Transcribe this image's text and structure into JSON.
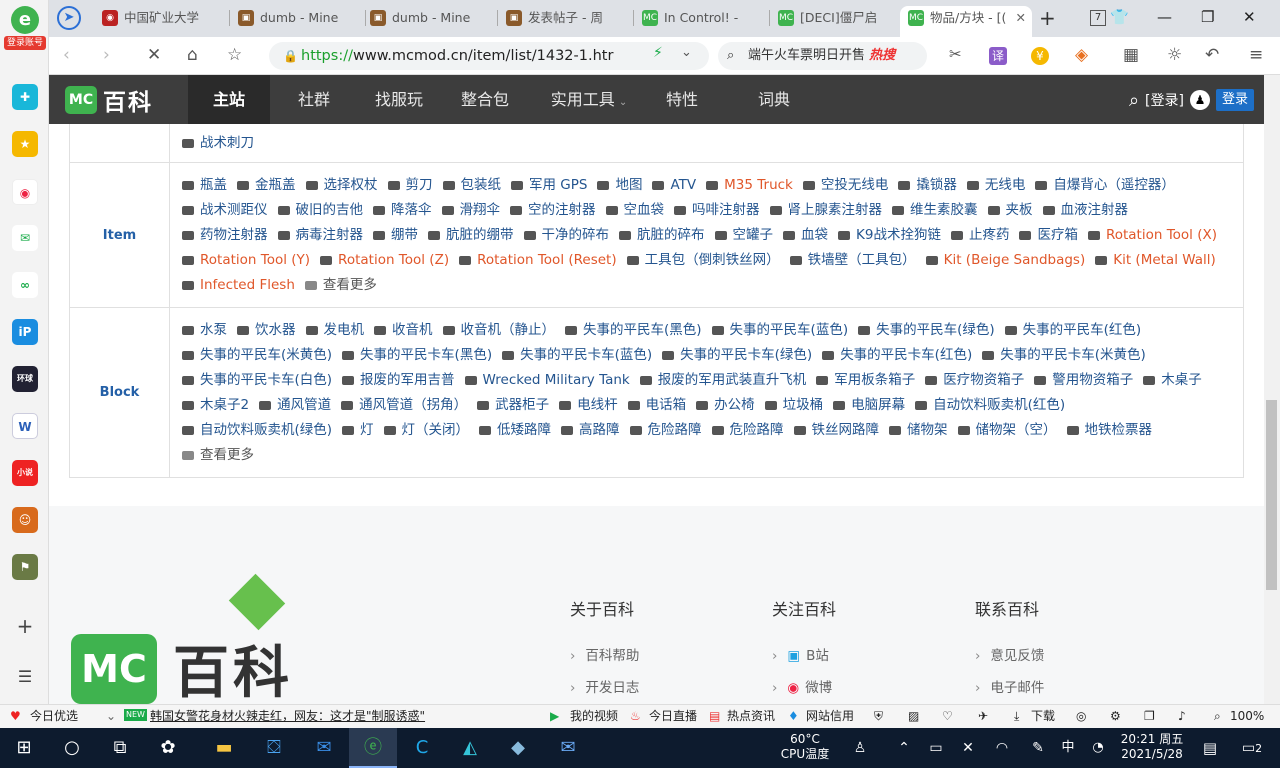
{
  "browser": {
    "login_badge": "登录账号",
    "tabs": [
      {
        "title": "中国矿业大学"
      },
      {
        "title": "dumb - Mine"
      },
      {
        "title": "dumb - Mine"
      },
      {
        "title": "发表帖子 - 周"
      },
      {
        "title": "In Control! -"
      },
      {
        "title": "[DECI]僵尸启"
      },
      {
        "title": "物品/方块 - [("
      }
    ],
    "tab_count": "7",
    "url": "https://www.mcmod.cn/item/list/1432-1.htr",
    "url_scheme": "https://",
    "url_rest": "www.mcmod.cn/item/list/1432-1.htr",
    "search_text": "端午火车票明日开售",
    "search_hot": "热搜"
  },
  "site": {
    "logo_text": "百科",
    "logo_badge": "MC",
    "nav": [
      "主站",
      "社群",
      "找服玩",
      "整合包",
      "实用工具",
      "特性",
      "词典"
    ],
    "login_link": "[登录]",
    "login_button": "登录"
  },
  "content": {
    "top_cell_item": "战术刺刀",
    "item_header": "Item",
    "block_header": "Block",
    "items": [
      {
        "t": "瓶盖"
      },
      {
        "t": "金瓶盖"
      },
      {
        "t": "选择权杖"
      },
      {
        "t": "剪刀"
      },
      {
        "t": "包装纸"
      },
      {
        "t": "军用 GPS"
      },
      {
        "t": "地图"
      },
      {
        "t": "ATV"
      },
      {
        "t": "M35 Truck",
        "red": true
      },
      {
        "t": "空投无线电"
      },
      {
        "t": "撬锁器"
      },
      {
        "t": "无线电"
      },
      {
        "t": "自爆背心（遥控器）"
      },
      {
        "t": "战术测距仪"
      },
      {
        "t": "破旧的吉他"
      },
      {
        "t": "降落伞"
      },
      {
        "t": "滑翔伞"
      },
      {
        "t": "空的注射器"
      },
      {
        "t": "空血袋"
      },
      {
        "t": "吗啡注射器"
      },
      {
        "t": "肾上腺素注射器"
      },
      {
        "t": "维生素胶囊"
      },
      {
        "t": "夹板"
      },
      {
        "t": "血液注射器"
      },
      {
        "t": "药物注射器"
      },
      {
        "t": "病毒注射器"
      },
      {
        "t": "绷带"
      },
      {
        "t": "肮脏的绷带"
      },
      {
        "t": "干净的碎布"
      },
      {
        "t": "肮脏的碎布"
      },
      {
        "t": "空罐子"
      },
      {
        "t": "血袋"
      },
      {
        "t": "K9战术拴狗链"
      },
      {
        "t": "止疼药"
      },
      {
        "t": "医疗箱"
      },
      {
        "t": "Rotation Tool (X)",
        "red": true
      },
      {
        "t": "Rotation Tool (Y)",
        "red": true
      },
      {
        "t": "Rotation Tool (Z)",
        "red": true
      },
      {
        "t": "Rotation Tool (Reset)",
        "red": true
      },
      {
        "t": "工具包（倒刺铁丝网）"
      },
      {
        "t": "铁墙壁（工具包）"
      },
      {
        "t": "Kit (Beige Sandbags)",
        "red": true
      },
      {
        "t": "Kit (Metal Wall)",
        "red": true
      },
      {
        "t": "Infected Flesh",
        "red": true
      }
    ],
    "blocks": [
      {
        "t": "水泵"
      },
      {
        "t": "饮水器"
      },
      {
        "t": "发电机"
      },
      {
        "t": "收音机"
      },
      {
        "t": "收音机（静止）"
      },
      {
        "t": "失事的平民车(黑色)"
      },
      {
        "t": "失事的平民车(蓝色)"
      },
      {
        "t": "失事的平民车(绿色)"
      },
      {
        "t": "失事的平民车(红色)"
      },
      {
        "t": "失事的平民车(米黄色)"
      },
      {
        "t": "失事的平民卡车(黑色)"
      },
      {
        "t": "失事的平民卡车(蓝色)"
      },
      {
        "t": "失事的平民卡车(绿色)"
      },
      {
        "t": "失事的平民卡车(红色)"
      },
      {
        "t": "失事的平民卡车(米黄色)"
      },
      {
        "t": "失事的平民卡车(白色)"
      },
      {
        "t": "报废的军用吉普"
      },
      {
        "t": "Wrecked Military Tank"
      },
      {
        "t": "报废的军用武装直升飞机"
      },
      {
        "t": "军用板条箱子"
      },
      {
        "t": "医疗物资箱子"
      },
      {
        "t": "警用物资箱子"
      },
      {
        "t": "木桌子"
      },
      {
        "t": "木桌子2"
      },
      {
        "t": "通风管道"
      },
      {
        "t": "通风管道（拐角）"
      },
      {
        "t": "武器柜子"
      },
      {
        "t": "电线杆"
      },
      {
        "t": "电话箱"
      },
      {
        "t": "办公椅"
      },
      {
        "t": "垃圾桶"
      },
      {
        "t": "电脑屏幕"
      },
      {
        "t": "自动饮料贩卖机(红色)"
      },
      {
        "t": "自动饮料贩卖机(绿色)"
      },
      {
        "t": "灯"
      },
      {
        "t": "灯（关闭）"
      },
      {
        "t": "低矮路障"
      },
      {
        "t": "高路障"
      },
      {
        "t": "危险路障"
      },
      {
        "t": "危险路障"
      },
      {
        "t": "铁丝网路障"
      },
      {
        "t": "储物架"
      },
      {
        "t": "储物架（空）"
      },
      {
        "t": "地铁检票器"
      }
    ],
    "see_more": "查看更多"
  },
  "footer": {
    "logo_badge": "MC",
    "logo_text": "百科",
    "about": {
      "title": "关于百科",
      "links": [
        "百科帮助",
        "开发日志"
      ]
    },
    "follow": {
      "title": "关注百科",
      "links": [
        "B站",
        "微博"
      ]
    },
    "contact": {
      "title": "联系百科",
      "links": [
        "意见反馈",
        "电子邮件"
      ]
    }
  },
  "statusbar": {
    "left": "今日优选",
    "news_tag": "NEW",
    "news": "韩国女警花身材火辣走红，网友：这才是\"制服诱惑\"",
    "my_video": "我的视频",
    "live": "今日直播",
    "hot_news": "热点资讯",
    "credit": "网站信用",
    "download": "下载",
    "zoom": "100%"
  },
  "taskbar": {
    "temp": "60°C",
    "temp_label": "CPU温度",
    "ime": "中",
    "time": "20:21 周五",
    "date": "2021/5/28",
    "notif": "2"
  }
}
